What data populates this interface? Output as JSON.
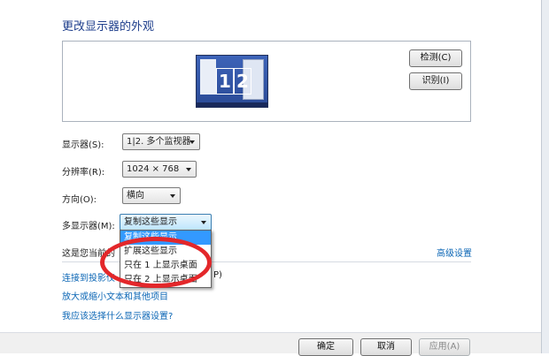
{
  "heading": "更改显示器的外观",
  "preview": {
    "monitor_labels": [
      "1",
      "2"
    ],
    "detect_button": "检测(C)",
    "identify_button": "识别(I)"
  },
  "settings": {
    "display_label": "显示器(S):",
    "display_value": "1|2. 多个监视器",
    "resolution_label": "分辨率(R):",
    "resolution_value": "1024 × 768",
    "orientation_label": "方向(O):",
    "orientation_value": "横向",
    "multi_label": "多显示器(M):",
    "multi_value": "复制这些显示"
  },
  "multi_options": [
    "复制这些显示",
    "扩展这些显示",
    "只在 1 上显示桌面",
    "只在 2 上显示桌面"
  ],
  "selected_option_index": 0,
  "current_text": "这是您当前的",
  "advanced_link": "高级设置",
  "links": {
    "projector": "连接到投影仪",
    "projector_tail": "P)",
    "enlarge": "放大或缩小文本和其他项目",
    "which_settings": "我应该选择什么显示器设置?"
  },
  "footer": {
    "ok": "确定",
    "cancel": "取消",
    "apply": "应用(A)"
  },
  "colors": {
    "heading": "#1e3e8c",
    "link": "#0b66b5",
    "selection": "#3399ff",
    "annotation_ring": "#e3272a"
  }
}
